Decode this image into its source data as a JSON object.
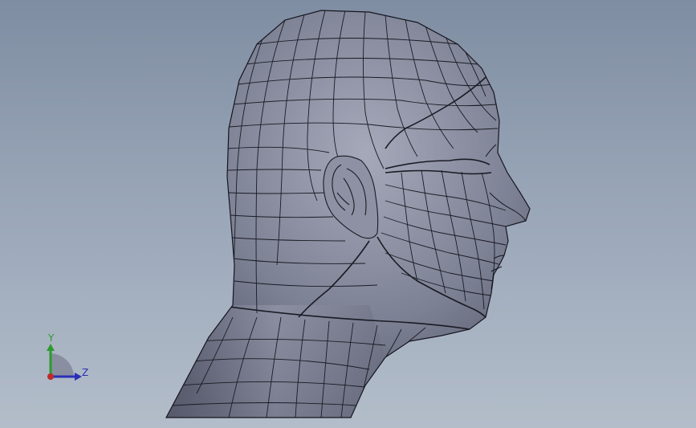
{
  "viewport": {
    "background_top": "#7f8da2",
    "background_bottom": "#b3bdca",
    "model": {
      "name": "head-model",
      "surface_color": "#7b7f92",
      "edge_color": "#1a1b24"
    }
  },
  "triad": {
    "y_label": "Y",
    "z_label": "Z",
    "y_color": "#2c9a2c",
    "z_color": "#2a2fb8",
    "x_color": "#c0282a"
  }
}
